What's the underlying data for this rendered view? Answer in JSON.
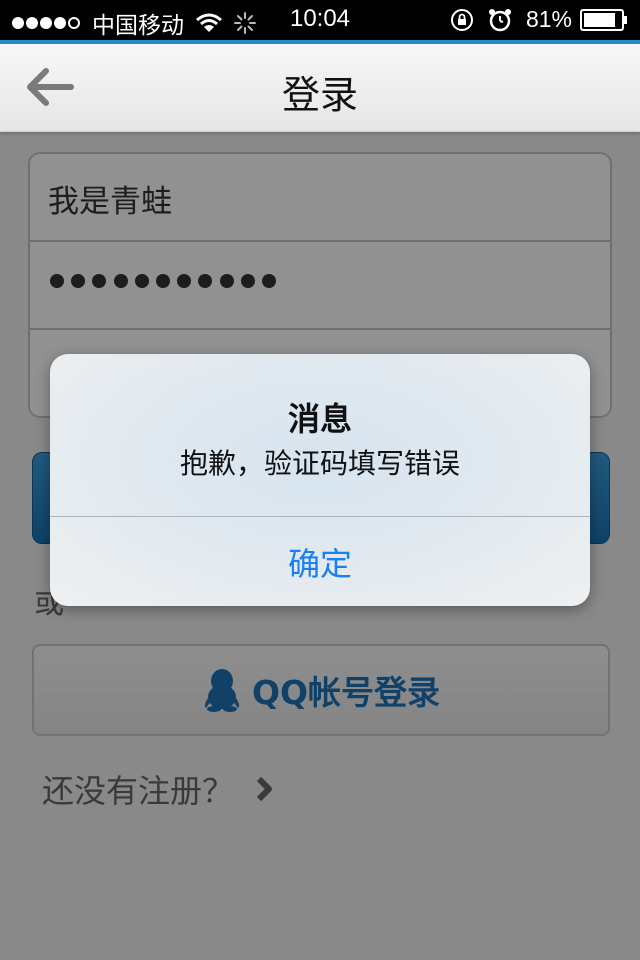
{
  "status_bar": {
    "carrier": "中国移动",
    "time": "10:04",
    "battery": "81%",
    "icons": [
      "signal-dots",
      "wifi-icon",
      "spinner-icon",
      "lock-rotation-icon",
      "alarm-icon",
      "battery-icon"
    ]
  },
  "nav": {
    "title": "登录",
    "back_icon": "arrow-left-icon",
    "accent_color": "#2a8bc9"
  },
  "form": {
    "username_value": "我是青蛙",
    "password_masked": "●●●●●●●●●●●",
    "password_length": 11
  },
  "login_button": {
    "color": "#1b74b8"
  },
  "or_text": "或",
  "qq_login": {
    "label": "QQ帐号登录",
    "icon": "qq-penguin-icon",
    "color": "#1e73b6"
  },
  "register": {
    "label": "还没有注册？",
    "icon": "chevron-right-icon"
  },
  "alert": {
    "title": "消息",
    "message": "抱歉，验证码填写错误",
    "button_label": "确定",
    "button_color": "#1a7ff0"
  }
}
